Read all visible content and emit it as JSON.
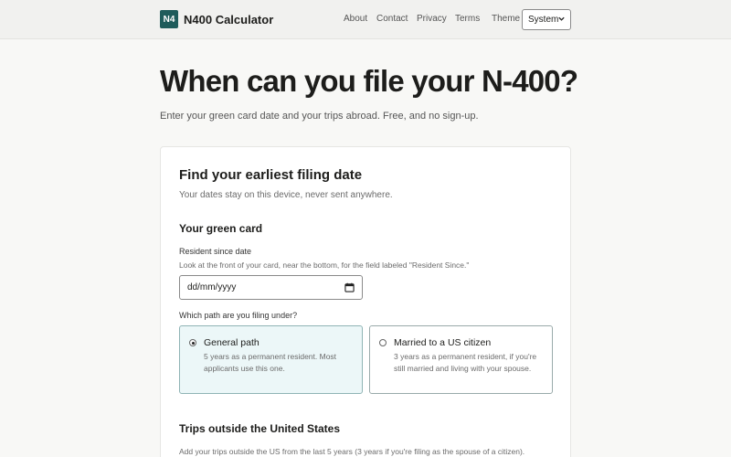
{
  "header": {
    "logo_text": "N4",
    "app_name": "N400 Calculator",
    "nav": [
      "About",
      "Contact",
      "Privacy",
      "Terms"
    ],
    "theme_label": "Theme",
    "theme_value": "System"
  },
  "hero": {
    "title": "When can you file your N-400?",
    "subtitle": "Enter your green card date and your trips abroad. Free, and no sign-up."
  },
  "card": {
    "title": "Find your earliest filing date",
    "subtitle": "Your dates stay on this device, never sent anywhere.",
    "green_card_section": "Your green card",
    "resident_label": "Resident since date",
    "resident_hint": "Look at the front of your card, near the bottom, for the field labeled \"Resident Since.\"",
    "date_placeholder": "dd/mm/yyyy",
    "path_question": "Which path are you filing under?",
    "options": [
      {
        "title": "General path",
        "description": "5 years as a permanent resident. Most applicants use this one.",
        "selected": true
      },
      {
        "title": "Married to a US citizen",
        "description": "3 years as a permanent resident, if you're still married and living with your spouse.",
        "selected": false
      }
    ],
    "trips_section": "Trips outside the United States",
    "trips_description": "Add your trips outside the US from the last 5 years (3 years if you're filing as the spouse of a citizen)."
  },
  "colors": {
    "brand": "#1f5c5b",
    "selected_bg": "#ecf7f8"
  },
  "icons": [
    "calendar-icon",
    "chevron-down-icon"
  ]
}
